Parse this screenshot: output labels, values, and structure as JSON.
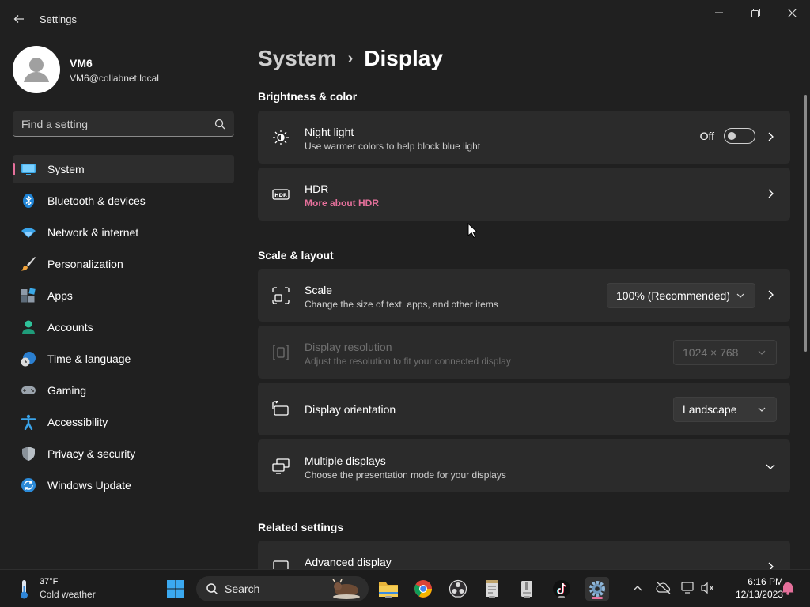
{
  "app": {
    "title": "Settings"
  },
  "profile": {
    "name": "VM6",
    "email": "VM6@collabnet.local"
  },
  "search": {
    "placeholder": "Find a setting"
  },
  "sidebar": {
    "items": [
      {
        "label": "System",
        "icon": "monitor-icon",
        "selected": true
      },
      {
        "label": "Bluetooth & devices",
        "icon": "bluetooth-icon"
      },
      {
        "label": "Network & internet",
        "icon": "wifi-icon"
      },
      {
        "label": "Personalization",
        "icon": "brush-icon"
      },
      {
        "label": "Apps",
        "icon": "apps-icon"
      },
      {
        "label": "Accounts",
        "icon": "person-icon"
      },
      {
        "label": "Time & language",
        "icon": "clock-globe-icon"
      },
      {
        "label": "Gaming",
        "icon": "gamepad-icon"
      },
      {
        "label": "Accessibility",
        "icon": "accessibility-icon"
      },
      {
        "label": "Privacy & security",
        "icon": "shield-icon"
      },
      {
        "label": "Windows Update",
        "icon": "update-icon"
      }
    ]
  },
  "breadcrumb": {
    "parent": "System",
    "separator": "›",
    "current": "Display"
  },
  "sections": {
    "brightness": "Brightness & color",
    "scale_layout": "Scale & layout",
    "related": "Related settings"
  },
  "cards": {
    "night_light": {
      "title": "Night light",
      "subtitle": "Use warmer colors to help block blue light",
      "state": "Off"
    },
    "hdr": {
      "title": "HDR",
      "link": "More about HDR"
    },
    "scale": {
      "title": "Scale",
      "subtitle": "Change the size of text, apps, and other items",
      "value": "100% (Recommended)"
    },
    "resolution": {
      "title": "Display resolution",
      "subtitle": "Adjust the resolution to fit your connected display",
      "value": "1024 × 768"
    },
    "orientation": {
      "title": "Display orientation",
      "value": "Landscape"
    },
    "multiple": {
      "title": "Multiple displays",
      "subtitle": "Choose the presentation mode for your displays"
    },
    "advanced": {
      "title": "Advanced display"
    }
  },
  "taskbar": {
    "weather_temp": "37°F",
    "weather_desc": "Cold weather",
    "search_label": "Search",
    "time": "6:16 PM",
    "date": "12/13/2023"
  },
  "colors": {
    "accent": "#e5709b",
    "background": "#202020",
    "card": "#2b2b2b"
  }
}
